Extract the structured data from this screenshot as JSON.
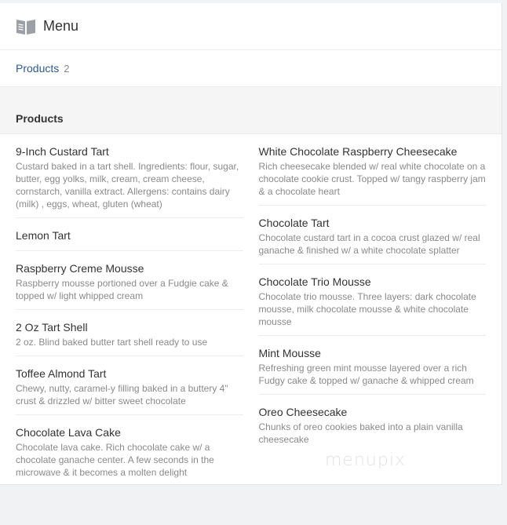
{
  "header": {
    "title": "Menu",
    "icon": "book-icon"
  },
  "tabs": [
    {
      "label": "Products",
      "count": "2"
    }
  ],
  "section": {
    "title": "Products"
  },
  "left_items": [
    {
      "name": "9-Inch Custard Tart",
      "desc": "Custard baked in a tart shell. Ingredients: flour, sugar, butter, egg yolks, milk, cream, cream cheese, cornstarch, vanilla extract. Allergens: contains dairy (milk) , eggs, wheat, gluten (wheat)"
    },
    {
      "name": "Lemon Tart",
      "desc": ""
    },
    {
      "name": "Raspberry Creme Mousse",
      "desc": "Raspberry mousse portioned over a Fudgie cake & topped w/ light whipped cream"
    },
    {
      "name": "2 Oz Tart Shell",
      "desc": "2 oz. Blind baked butter tart shell ready to use"
    },
    {
      "name": "Toffee Almond Tart",
      "desc": "Chewy, nutty, caramel-y filling baked in a buttery 4\" crust & drizzled w/ bitter sweet chocolate"
    },
    {
      "name": "Chocolate Lava Cake",
      "desc": "Chocolate lava cake. Rich chocolate cake w/ a chocolate ganache center. A few seconds in the microwave & it becomes a molten delight"
    }
  ],
  "right_items": [
    {
      "name": "White Chocolate Raspberry Cheesecake",
      "desc": "Rich cheesecake blended w/ real white chocolate on a chocolate cookie crust. Topped w/ tangy raspberry jam & a chocolate heart"
    },
    {
      "name": "Chocolate Tart",
      "desc": "Chocolate custard tart in a cocoa crust glazed w/ real ganache & finished w/ a white chocolate splatter"
    },
    {
      "name": "Chocolate Trio Mousse",
      "desc": "Chocolate trio mousse. Three layers: dark chocolate mousse, milk chocolate mousse & white chocolate mousse"
    },
    {
      "name": "Mint Mousse",
      "desc": "Refreshing green mint mousse layered over a rich Fudgy cake & topped w/ ganache & whipped cream"
    },
    {
      "name": "Oreo Cheesecake",
      "desc": "Chunks of oreo cookies baked into a plain vanilla cheesecake"
    }
  ],
  "watermark": "menupix"
}
